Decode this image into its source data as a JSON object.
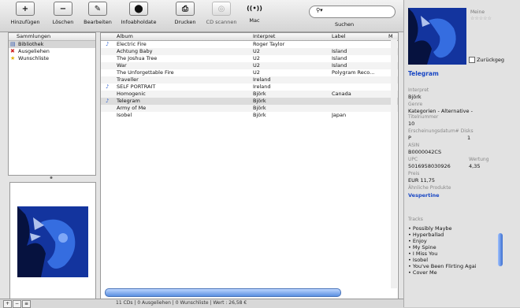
{
  "toolbar": {
    "buttons": [
      {
        "label": "Hinzufügen",
        "glyph": "+"
      },
      {
        "label": "Löschen",
        "glyph": "−"
      },
      {
        "label": "Bearbeiten",
        "glyph": "✎"
      },
      {
        "label": "Infoabholdate",
        "glyph": "⬤"
      },
      {
        "label": "Drucken",
        "glyph": "⎙"
      },
      {
        "label": "CD scannen",
        "glyph": "◎"
      },
      {
        "label": "Mac",
        "glyph": "((•))"
      }
    ],
    "search_label": "Suchen",
    "search_icon": "search-icon"
  },
  "sidebar": {
    "header": "Sammlungen",
    "items": [
      {
        "label": "Bibliothek",
        "icon": "library-icon",
        "selected": true
      },
      {
        "label": "Ausgeliehen",
        "icon": "loan-icon",
        "selected": false
      },
      {
        "label": "Wunschliste",
        "icon": "star-icon",
        "selected": false
      }
    ]
  },
  "list": {
    "columns": [
      "Album",
      "Interpret",
      "Label",
      "M"
    ],
    "rows": [
      {
        "album": "Electric Fire",
        "artist": "Roger Taylor",
        "label": "",
        "note": true,
        "selected": false
      },
      {
        "album": "Achtung Baby",
        "artist": "U2",
        "label": "Island",
        "note": false,
        "selected": false
      },
      {
        "album": "The Joshua Tree",
        "artist": "U2",
        "label": "Island",
        "note": false,
        "selected": false
      },
      {
        "album": "War",
        "artist": "U2",
        "label": "Island",
        "note": false,
        "selected": false
      },
      {
        "album": "The Unforgettable Fire",
        "artist": "U2",
        "label": "Polygram Reco...",
        "note": false,
        "selected": false
      },
      {
        "album": "Traveller",
        "artist": "Ireland",
        "label": "",
        "note": false,
        "selected": false
      },
      {
        "album": "SELF PORTRAIT",
        "artist": "Ireland",
        "label": "",
        "note": true,
        "selected": false
      },
      {
        "album": "Homogenic",
        "artist": "Björk",
        "label": "Canada",
        "note": false,
        "selected": false
      },
      {
        "album": "Telegram",
        "artist": "Björk",
        "label": "",
        "note": true,
        "selected": true
      },
      {
        "album": "Army of Me",
        "artist": "Björk",
        "label": "",
        "note": false,
        "selected": false
      },
      {
        "album": "Isobel",
        "artist": "Björk",
        "label": "Japan",
        "note": false,
        "selected": false
      }
    ]
  },
  "status": {
    "text": "11 CDs | 0 Ausgeliehen | 0 Wunschliste | Wert : 26,58 €"
  },
  "panel": {
    "meine": "Meine",
    "stars": "☆☆☆☆☆",
    "zurueck": "Zurückgeg",
    "title": "Telegram",
    "interpret_label": "Interpret",
    "interpret": "Björk",
    "genre_label": "Genre",
    "genre": "Kategorien - Alternative -",
    "titelnummer_label": "Titelnummer",
    "titelnummer": "10",
    "erschienen_label": "Erscheinungsdatum# Disks",
    "erschienen_left": "P",
    "erschienen_right": "1",
    "asin_label": "ASIN",
    "asin": "B0000042CS",
    "upc_label": "UPC",
    "upc": "5016958030926",
    "wertung_label": "Wertung",
    "wertung": "4,35",
    "preis_label": "Preis",
    "preis": "EUR 11,75",
    "aehnlich_label": "Ähnliche Produkte",
    "aehnlich": "Vespertine",
    "tracks_label": "Tracks",
    "tracks": [
      "• Possibly Maybe",
      "• Hyperballad",
      "• Enjoy",
      "• My Spine",
      "• I Miss You",
      "• Isobel",
      "• You've Been Flirting Agai",
      "• Cover Me"
    ]
  }
}
